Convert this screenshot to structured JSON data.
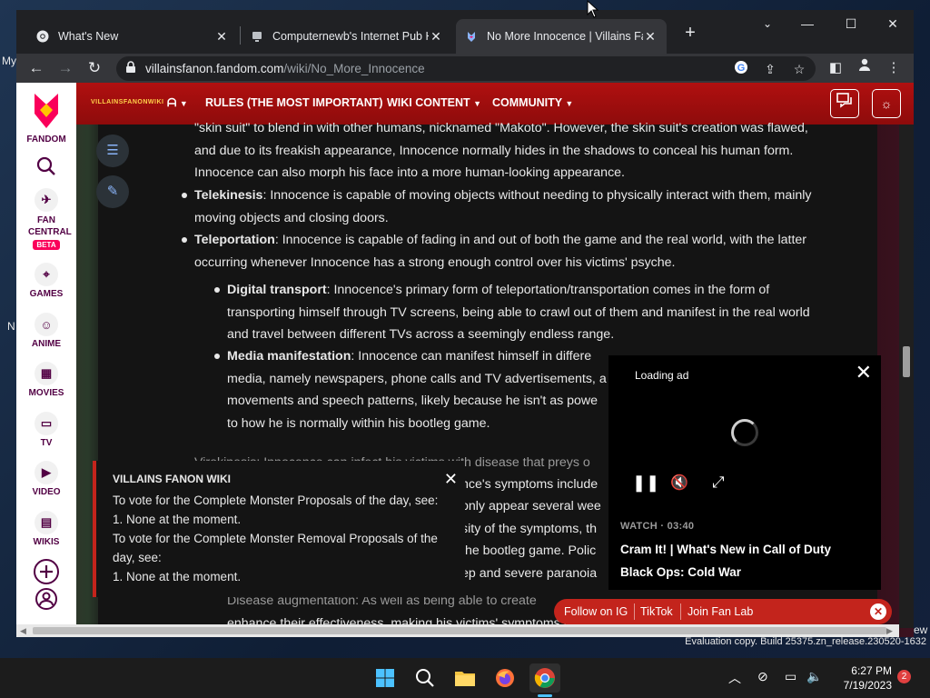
{
  "desktop": {
    "left_label_top": "My",
    "left_label_mid": "N",
    "right_label": "ew"
  },
  "browser": {
    "tabs": [
      {
        "title": "What's New",
        "favicon": "chrome-icon"
      },
      {
        "title": "Computernewb's Internet Pub H",
        "favicon": "computernewb-icon"
      },
      {
        "title": "No More Innocence | Villains Fa",
        "favicon": "fandom-icon",
        "active": true
      }
    ],
    "address": {
      "host": "villainsfanon.fandom.com",
      "path": "/wiki/No_More_Innocence"
    }
  },
  "fandom_rail": {
    "brand": "FANDOM",
    "items": [
      "FAN CENTRAL",
      "GAMES",
      "ANIME",
      "MOVIES",
      "TV",
      "VIDEO",
      "WIKIS"
    ],
    "beta": "BETA"
  },
  "wiki_nav": {
    "logo_text": "VILLAINSFANONWIKI",
    "links": [
      "RULES (THE MOST IMPORTANT)",
      "WIKI CONTENT",
      "COMMUNITY"
    ]
  },
  "article": {
    "intro_lines": [
      "\"skin suit\" to blend in with other humans, nicknamed \"Makoto\". However, the skin suit's creation was flawed,",
      "and due to its freakish appearance, Innocence normally hides in the shadows to conceal his human form.",
      "Innocence can also morph his face into a more human-looking appearance."
    ],
    "telekinesis_term": "Telekinesis",
    "telekinesis_line1": ": Innocence is capable of moving objects without needing to physically interact with them, mainly",
    "telekinesis_line2": "moving objects and closing doors.",
    "teleportation_term": "Teleportation",
    "teleportation_line1": ": Innocence is capable of fading in and out of both the game and the real world, with the latter",
    "teleportation_line2": "occurring whenever Innocence has a strong enough control over his victims' psyche.",
    "digital_term": "Digital transport",
    "digital_line1": ": Innocence's primary form of teleportation/transportation comes in the form of",
    "digital_line2": "transporting himself through TV screens, being able to crawl out of them and manifest in the real world",
    "digital_line3": "and travel between different TVs across a seemingly endless range.",
    "media_term": "Media manifestation",
    "media_line1": ": Innocence can manifest himself in differe",
    "media_line2": "media, namely newspapers, phone calls and TV advertisements, a",
    "media_line3": "movements and speech patterns, likely because he isn't as powe",
    "media_line4": "to how he is normally within his bootleg game.",
    "virokinesis_fragment": "Virokinesis: Innocence can infect his victims with disease that preys o",
    "frag_symptoms": "nce's symptoms include",
    "frag_several": "only appear several wee",
    "frag_severity": "sity of the symptoms, th",
    "frag_bootleg": "the bootleg game. Polic",
    "frag_paranoia": "ep and severe paranoia",
    "frag_augment": "Disease augmentation: As well as being able to create",
    "frag_enhance": "enhance their effectiveness, making his victims' symptoms more severe and leading to their mental"
  },
  "notice": {
    "title": "VILLAINS FANON WIKI",
    "lines": [
      "To vote for the Complete Monster Proposals of the day, see:",
      "1. None at the moment.",
      "To vote for the Complete Monster Removal Proposals of the",
      "day, see:",
      "1. None at the moment."
    ]
  },
  "ad": {
    "loading": "Loading ad",
    "watch": "WATCH · 03:40",
    "title_line1": "Cram It! | What's New in Call of Duty",
    "title_line2": "Black Ops: Cold War"
  },
  "social": {
    "items": [
      "Follow on IG",
      "TikTok",
      "Join Fan Lab"
    ]
  },
  "watermark": "Evaluation copy. Build 25375.zn_release.230520-1632",
  "taskbar": {
    "time": "6:27 PM",
    "date": "7/19/2023",
    "notifications": "2"
  },
  "colors": {
    "fandom_accent": "#fa005a",
    "wiki_nav_red": "#a00e0e",
    "article_bg": "#141414",
    "social_bar": "#c3241c"
  }
}
